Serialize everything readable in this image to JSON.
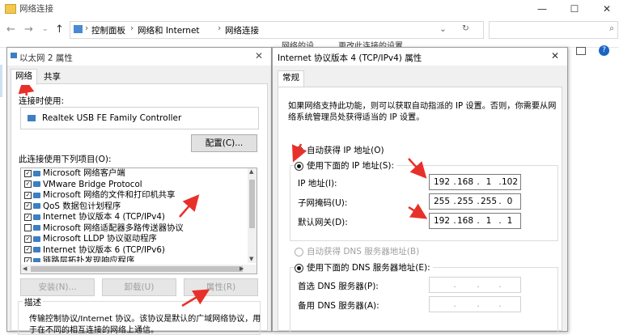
{
  "window": {
    "title": "网络连接",
    "breadcrumb": [
      "控制面板",
      "网络和 Internet",
      "网络连接"
    ],
    "partial_toolbar": [
      "…网络的设…",
      "…更改此连接的设置"
    ]
  },
  "eth_dialog": {
    "title": "以太网 2 属性",
    "tabs": [
      "网络",
      "共享"
    ],
    "connect_using_label": "连接时使用:",
    "adapter": "Realtek USB FE Family Controller",
    "configure_button": "配置(C)...",
    "items_label": "此连接使用下列项目(O):",
    "items": [
      {
        "label": "Microsoft 网络客户端",
        "checked": true
      },
      {
        "label": "VMware Bridge Protocol",
        "checked": true
      },
      {
        "label": "Microsoft 网络的文件和打印机共享",
        "checked": true
      },
      {
        "label": "QoS 数据包计划程序",
        "checked": true
      },
      {
        "label": "Internet 协议版本 4 (TCP/IPv4)",
        "checked": true
      },
      {
        "label": "Microsoft 网络适配器多路传送器协议",
        "checked": false
      },
      {
        "label": "Microsoft LLDP 协议驱动程序",
        "checked": true
      },
      {
        "label": "Internet 协议版本 6 (TCP/IPv6)",
        "checked": true
      },
      {
        "label": "链路层拓扑发现响应程序",
        "checked": true
      }
    ],
    "install_button": "安装(N)...",
    "uninstall_button": "卸载(U)",
    "properties_button": "属性(R)",
    "description_label": "描述",
    "description_text": "传输控制协议/Internet 协议。该协议是默认的广域网络协议，用",
    "description_text2": "于在不同的相互连接的网络上通信。"
  },
  "ipv4_dialog": {
    "title": "Internet 协议版本 4 (TCP/IPv4) 属性",
    "tab": "常规",
    "intro": "如果网络支持此功能，则可以获取自动指派的 IP 设置。否则，你需要从网",
    "intro2": "络系统管理员处获得适当的 IP 设置。",
    "auto_ip": "自动获得 IP 地址(O)",
    "manual_ip": "使用下面的 IP 地址(S):",
    "ip_label": "IP 地址(I):",
    "ip": [
      "192",
      "168",
      "1",
      "102"
    ],
    "mask_label": "子网掩码(U):",
    "mask": [
      "255",
      "255",
      "255",
      "0"
    ],
    "gateway_label": "默认网关(D):",
    "gateway": [
      "192",
      "168",
      "1",
      "1"
    ],
    "auto_dns": "自动获得 DNS 服务器地址(B)",
    "manual_dns": "使用下面的 DNS 服务器地址(E):",
    "dns1_label": "首选 DNS 服务器(P):",
    "dns2_label": "备用 DNS 服务器(A):"
  },
  "colors": {
    "accent": "#e8302a",
    "link_blue": "#0066cc"
  }
}
